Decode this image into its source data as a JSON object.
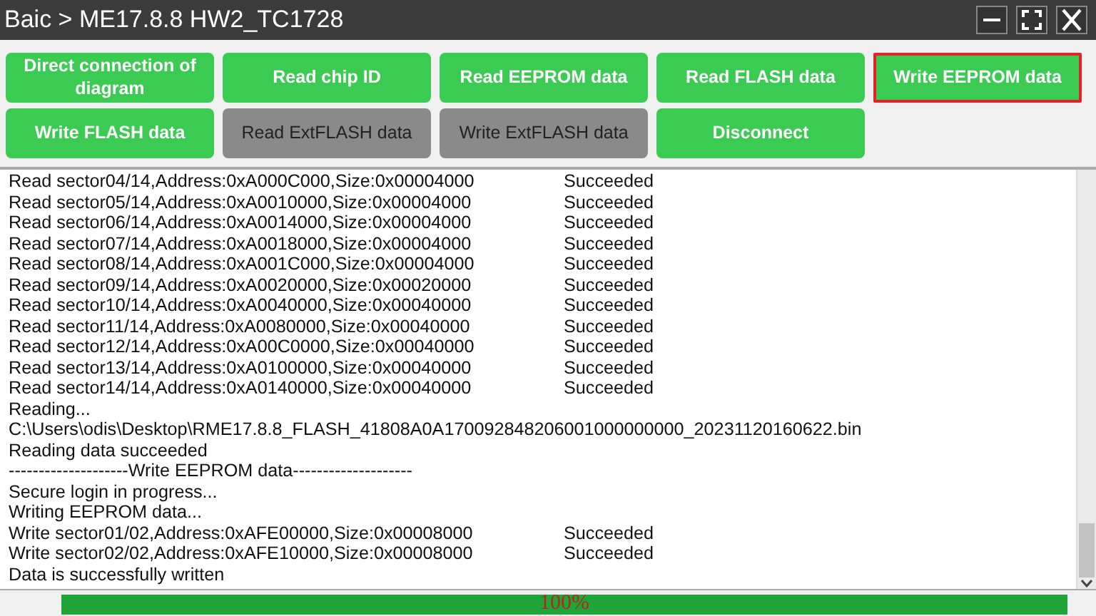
{
  "window": {
    "title": "Baic > ME17.8.8 HW2_TC1728"
  },
  "buttons": [
    {
      "label": "Direct connection of diagram",
      "disabled": false,
      "selected": false
    },
    {
      "label": "Read chip ID",
      "disabled": false,
      "selected": false
    },
    {
      "label": "Read EEPROM data",
      "disabled": false,
      "selected": false
    },
    {
      "label": "Read FLASH data",
      "disabled": false,
      "selected": false
    },
    {
      "label": "Write EEPROM data",
      "disabled": false,
      "selected": true
    },
    {
      "label": "Write FLASH data",
      "disabled": false,
      "selected": false
    },
    {
      "label": "Read ExtFLASH data",
      "disabled": true,
      "selected": false
    },
    {
      "label": "Write ExtFLASH data",
      "disabled": true,
      "selected": false
    },
    {
      "label": "Disconnect",
      "disabled": false,
      "selected": false
    }
  ],
  "log": [
    {
      "text": "Read sector04/14,Address:0xA000C000,Size:0x00004000",
      "status": "Succeeded"
    },
    {
      "text": "Read sector05/14,Address:0xA0010000,Size:0x00004000",
      "status": "Succeeded"
    },
    {
      "text": "Read sector06/14,Address:0xA0014000,Size:0x00004000",
      "status": "Succeeded"
    },
    {
      "text": "Read sector07/14,Address:0xA0018000,Size:0x00004000",
      "status": "Succeeded"
    },
    {
      "text": "Read sector08/14,Address:0xA001C000,Size:0x00004000",
      "status": "Succeeded"
    },
    {
      "text": "Read sector09/14,Address:0xA0020000,Size:0x00020000",
      "status": "Succeeded"
    },
    {
      "text": "Read sector10/14,Address:0xA0040000,Size:0x00040000",
      "status": "Succeeded"
    },
    {
      "text": "Read sector11/14,Address:0xA0080000,Size:0x00040000",
      "status": "Succeeded"
    },
    {
      "text": "Read sector12/14,Address:0xA00C0000,Size:0x00040000",
      "status": "Succeeded"
    },
    {
      "text": "Read sector13/14,Address:0xA0100000,Size:0x00040000",
      "status": "Succeeded"
    },
    {
      "text": "Read sector14/14,Address:0xA0140000,Size:0x00040000",
      "status": "Succeeded"
    },
    {
      "text": "Reading..."
    },
    {
      "text": "C:\\Users\\odis\\Desktop\\RME17.8.8_FLASH_41808A0A170092848206001000000000_20231120160622.bin"
    },
    {
      "text": "Reading data succeeded"
    },
    {
      "text": "--------------------Write EEPROM data--------------------"
    },
    {
      "text": "Secure login in progress..."
    },
    {
      "text": "Writing EEPROM data..."
    },
    {
      "text": "Write sector01/02,Address:0xAFE00000,Size:0x00008000",
      "status": "Succeeded"
    },
    {
      "text": "Write sector02/02,Address:0xAFE10000,Size:0x00008000",
      "status": "Succeeded"
    },
    {
      "text": "Data is successfully written"
    }
  ],
  "progress": {
    "level": 1.0,
    "label": "100%"
  }
}
